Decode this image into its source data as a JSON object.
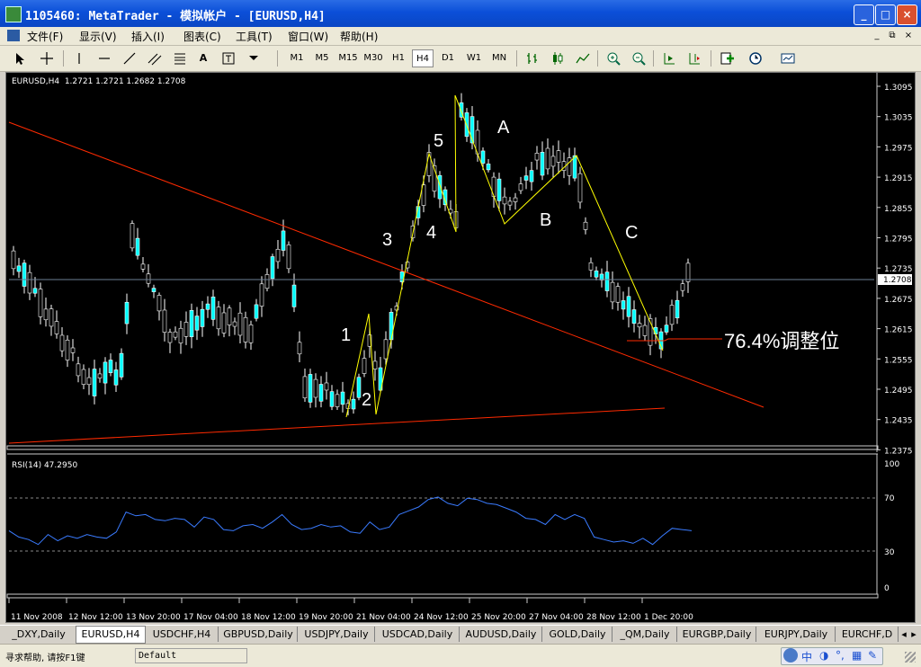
{
  "window": {
    "title": "1105460: MetaTrader - 模拟帐户 - [EURUSD,H4]",
    "minimize": "_",
    "maximize": "□",
    "close": "×"
  },
  "menu": [
    "文件(F)",
    "显示(V)",
    "插入(I)",
    "图表(C)",
    "工具(T)",
    "窗口(W)",
    "帮助(H)"
  ],
  "mdi_buttons": [
    "_",
    "⧉",
    "×"
  ],
  "toolbar": {
    "tools": [
      "cursor-icon",
      "crosshair-icon",
      "vertical-line-icon",
      "horizontal-line-icon",
      "trendline-icon",
      "channel-icon",
      "fibonacci-icon",
      "text-icon",
      "label-icon",
      "arrows-icon"
    ],
    "text_tool": "A",
    "timeframes": [
      "M1",
      "M5",
      "M15",
      "M30",
      "H1",
      "H4",
      "D1",
      "W1",
      "MN"
    ],
    "active_timeframe": "H4"
  },
  "chart": {
    "info": "EURUSD,H4  1.2721 1.2721 1.2682 1.2708",
    "price_labels": [
      "1.3095",
      "1.3035",
      "1.2975",
      "1.2915",
      "1.2855",
      "1.2795",
      "1.2735",
      "1.2675",
      "1.2615",
      "1.2555",
      "1.2495",
      "1.2435",
      "1.2375"
    ],
    "current_price": "1.2708",
    "wave_labels": [
      "1",
      "2",
      "3",
      "4",
      "5",
      "A",
      "B",
      "C"
    ],
    "annotation": "76.4%调整位",
    "colors": {
      "bull": "#00ffff",
      "bear": "#000000",
      "trend": "#ff2a00",
      "wave": "#ffff00",
      "rsi": "#3a7bff"
    }
  },
  "indicator": {
    "name": "RSI(14) 47.2950",
    "levels": [
      "100",
      "70",
      "30",
      "0"
    ],
    "values": [
      45,
      40,
      38,
      34,
      42,
      37,
      41,
      39,
      42,
      40,
      39,
      44,
      60,
      57,
      58,
      54,
      53,
      55,
      54,
      48,
      56,
      54,
      46,
      45,
      49,
      50,
      47,
      52,
      58,
      50,
      46,
      47,
      50,
      48,
      49,
      44,
      43,
      52,
      46,
      48,
      58,
      61,
      64,
      70,
      72,
      67,
      65,
      71,
      70,
      67,
      66,
      63,
      60,
      55,
      54,
      50,
      58,
      54,
      58,
      55,
      40,
      38,
      36,
      37,
      35,
      39,
      34,
      41,
      47,
      46,
      45
    ]
  },
  "time_labels": [
    "11 Nov 2008",
    "12 Nov 12:00",
    "13 Nov 20:00",
    "17 Nov 04:00",
    "18 Nov 12:00",
    "19 Nov 20:00",
    "21 Nov 04:00",
    "24 Nov 12:00",
    "25 Nov 20:00",
    "27 Nov 04:00",
    "28 Nov 12:00",
    "1 Dec 20:00"
  ],
  "tabs": [
    "_DXY,Daily",
    "EURUSD,H4",
    "USDCHF,H4",
    "GBPUSD,Daily",
    "USDJPY,Daily",
    "USDCAD,Daily",
    "AUDUSD,Daily",
    "GOLD,Daily",
    "_QM,Daily",
    "EURGBP,Daily",
    "EURJPY,Daily",
    "EURCHF,D"
  ],
  "active_tab": "EURUSD,H4",
  "status": {
    "help": "寻求帮助, 请按F1键",
    "profile": "Default",
    "ime_chars": [
      "中",
      "◑",
      "°,",
      "▦",
      "✎"
    ]
  }
}
